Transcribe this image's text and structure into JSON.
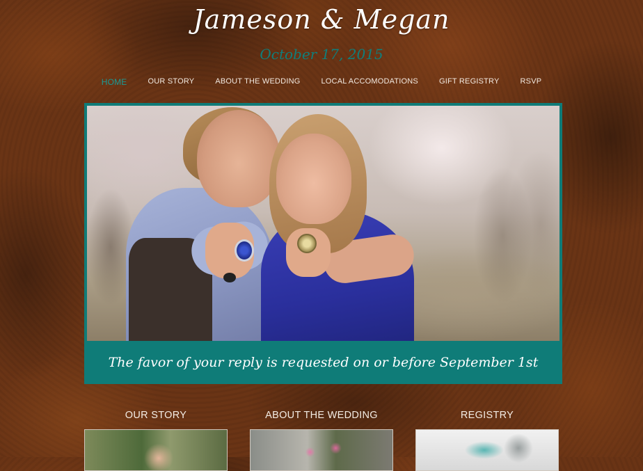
{
  "header": {
    "title": "Jameson & Megan",
    "date": "October 17, 2015"
  },
  "nav": {
    "items": [
      {
        "label": "HOME",
        "active": true
      },
      {
        "label": "OUR STORY",
        "active": false
      },
      {
        "label": "ABOUT THE WEDDING",
        "active": false
      },
      {
        "label": "LOCAL ACCOMODATIONS",
        "active": false
      },
      {
        "label": "GIFT REGISTRY",
        "active": false
      },
      {
        "label": "RSVP",
        "active": false
      }
    ]
  },
  "hero": {
    "caption": "The favor of your reply is requested on or before September 1st"
  },
  "sections": [
    {
      "heading": "OUR STORY"
    },
    {
      "heading": "ABOUT THE WEDDING"
    },
    {
      "heading": "REGISTRY"
    }
  ],
  "colors": {
    "accent": "#0f7c78",
    "background": "#6a3415",
    "nav_active": "#1a9a95"
  }
}
